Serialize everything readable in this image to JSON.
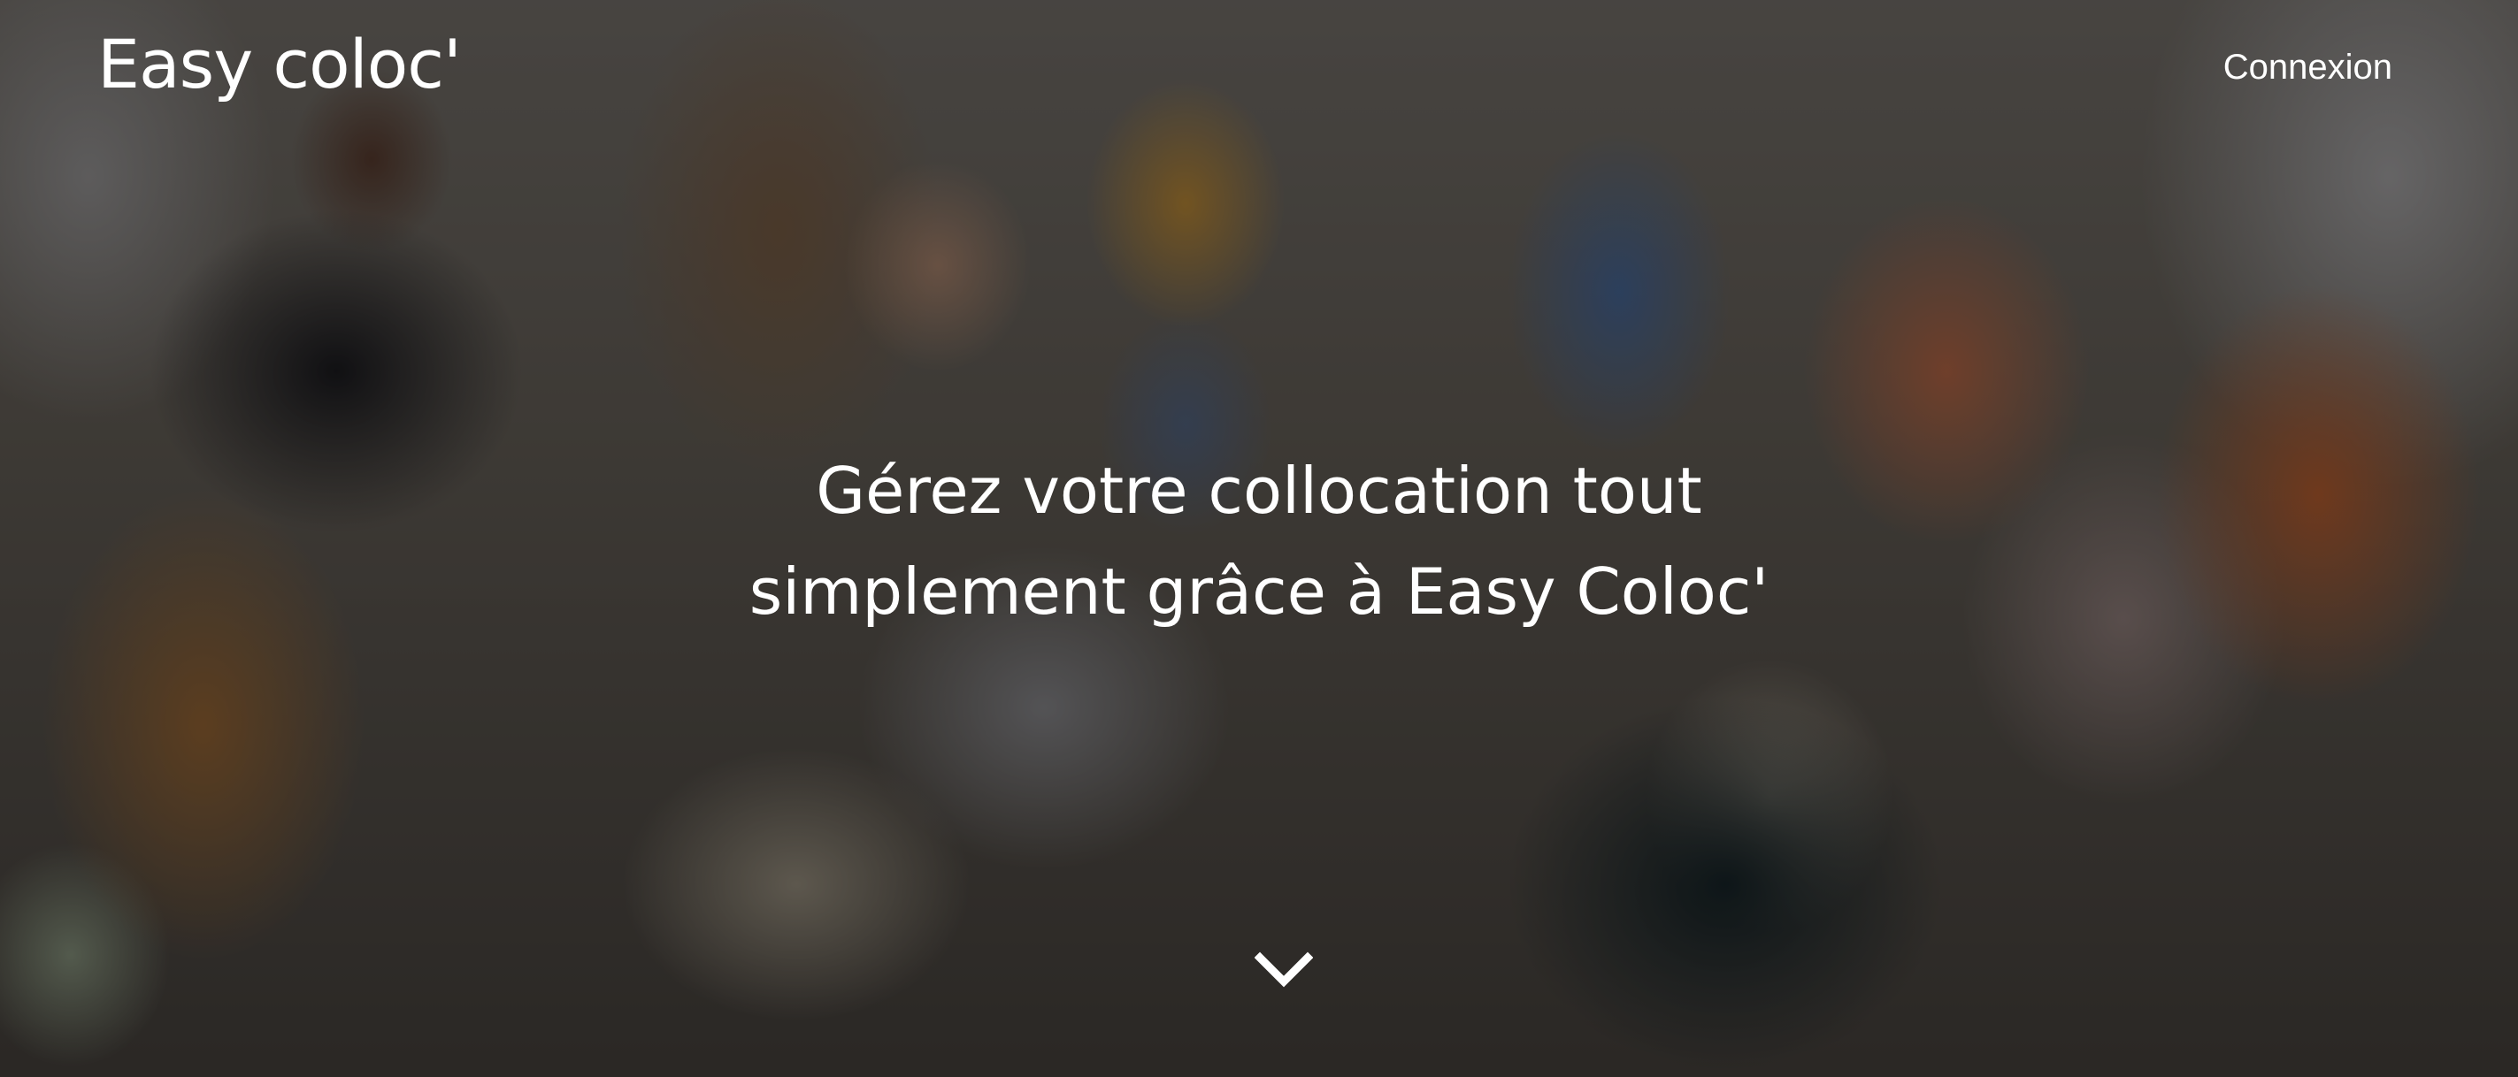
{
  "header": {
    "brand": "Easy coloc'",
    "login_label": "Connexion"
  },
  "hero": {
    "headline_line1": "Gérez votre collocation tout",
    "headline_line2": "simplement grâce à Easy Coloc'"
  },
  "icons": {
    "scroll": "chevron-down-icon"
  },
  "colors": {
    "text": "#ffffff",
    "overlay": "rgba(0,0,0,0.42)"
  }
}
